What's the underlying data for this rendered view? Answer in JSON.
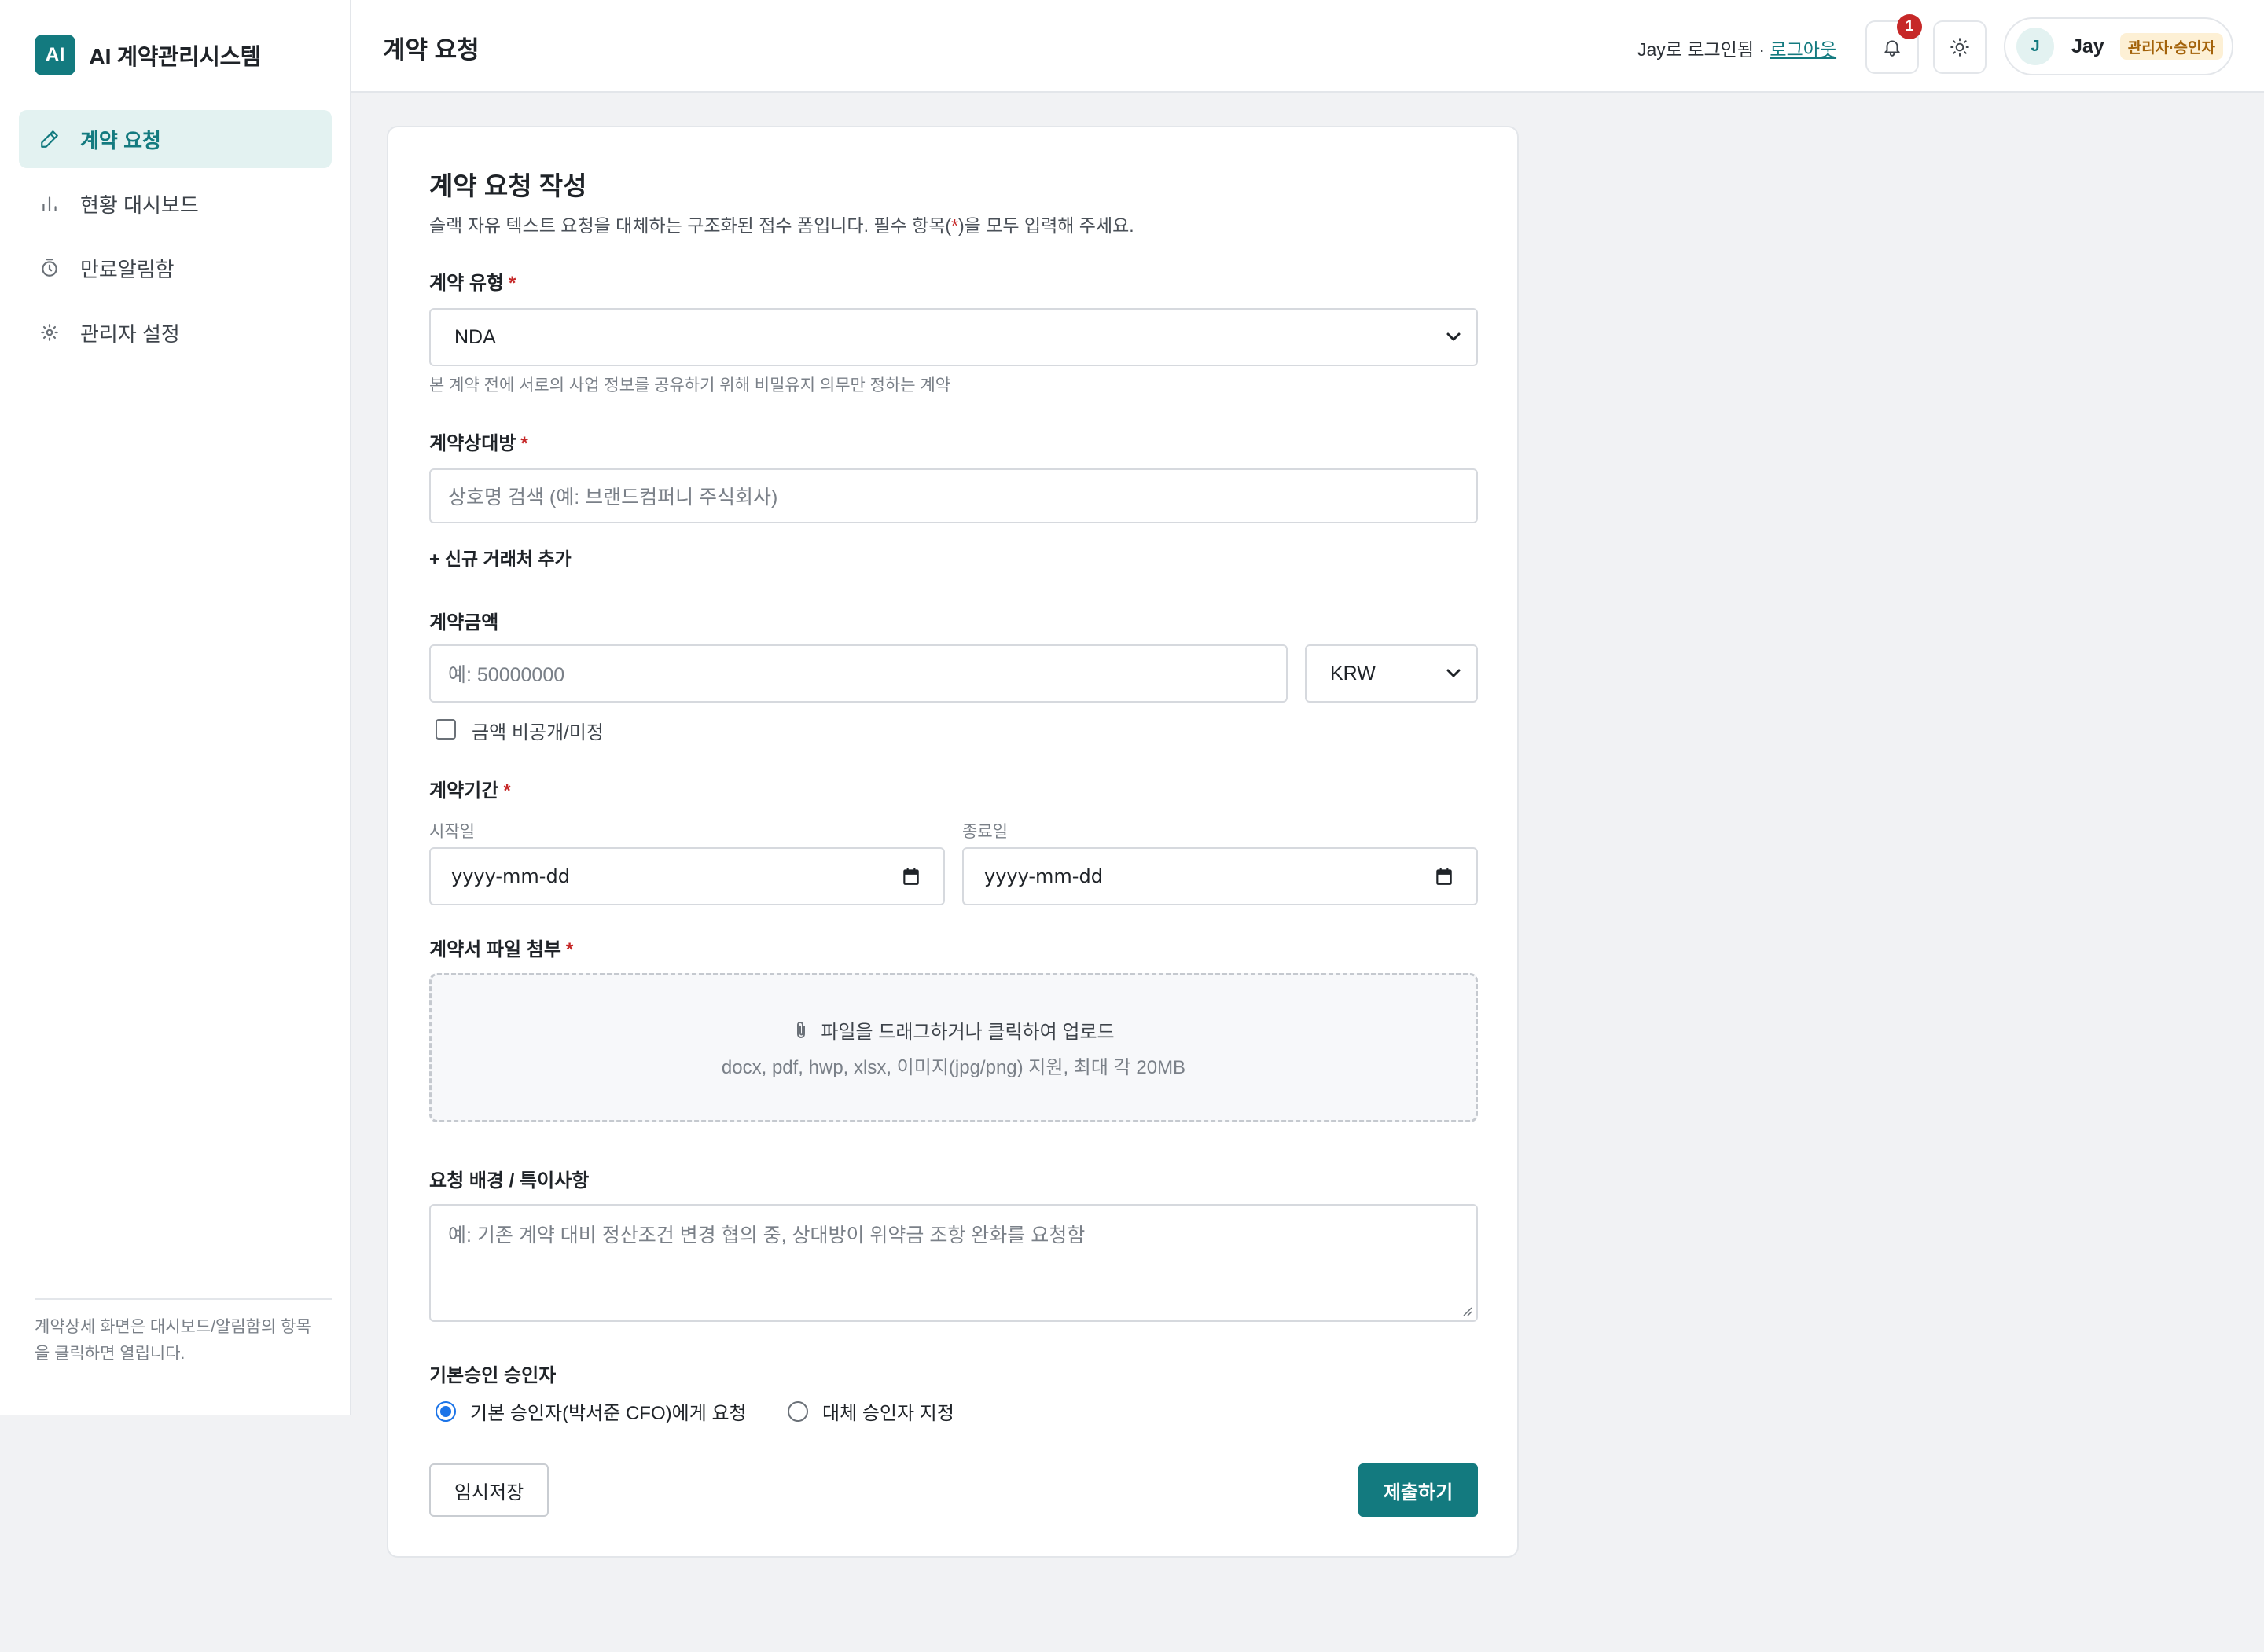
{
  "app": {
    "logo_text": "AI",
    "name": "AI 계약관리시스템"
  },
  "sidebar": {
    "items": [
      {
        "label": "계약 요청",
        "icon": "pencil-icon",
        "active": true
      },
      {
        "label": "현황 대시보드",
        "icon": "bar-chart-icon",
        "active": false
      },
      {
        "label": "만료알림함",
        "icon": "timer-icon",
        "active": false
      },
      {
        "label": "관리자 설정",
        "icon": "gear-icon",
        "active": false
      }
    ],
    "note": "계약상세 화면은 대시보드/알림함의 항목을 클릭하면 열립니다."
  },
  "header": {
    "title": "계약 요청",
    "login_text": "Jay로 로그인됨 · ",
    "logout_label": "로그아웃",
    "notification_count": "1",
    "user": {
      "initial": "J",
      "name": "Jay",
      "role": "관리자·승인자"
    }
  },
  "form": {
    "title": "계약 요청 작성",
    "description": {
      "before": "슬랙 자유 텍스트 요청을 대체하는 구조화된 접수 폼입니다. 필수 항목(",
      "star": "*",
      "after": ")을 모두 입력해 주세요."
    },
    "required_mark": "*",
    "contract_type": {
      "label": "계약 유형",
      "value": "NDA",
      "hint": "본 계약 전에 서로의 사업 정보를 공유하기 위해 비밀유지 의무만 정하는 계약"
    },
    "counterparty": {
      "label": "계약상대방",
      "placeholder": "상호명 검색 (예: 브랜드컴퍼니 주식회사)",
      "add_link": "+ 신규 거래처 추가"
    },
    "amount": {
      "label": "계약금액",
      "placeholder": "예: 50000000",
      "currency": "KRW",
      "undisclosed_label": "금액 비공개/미정",
      "undisclosed_checked": false
    },
    "period": {
      "label": "계약기간",
      "start_label": "시작일",
      "start_value": "yyyy-mm-dd",
      "end_label": "종료일",
      "end_value": "yyyy-mm-dd"
    },
    "attachment": {
      "label": "계약서 파일 첨부",
      "drop_text": "파일을 드래그하거나 클릭하여 업로드",
      "formats": "docx, pdf, hwp, xlsx, 이미지(jpg/png) 지원, 최대 각 20MB"
    },
    "background": {
      "label": "요청 배경 / 특이사항",
      "placeholder": "예: 기존 계약 대비 정산조건 변경 협의 중, 상대방이 위약금 조항 완화를 요청함"
    },
    "approver": {
      "label": "기본승인 승인자",
      "options": [
        {
          "label": "기본 승인자(박서준 CFO)에게 요청",
          "checked": true
        },
        {
          "label": "대체 승인자 지정",
          "checked": false
        }
      ]
    },
    "buttons": {
      "draft": "임시저장",
      "submit": "제출하기"
    }
  },
  "colors": {
    "accent": "#137a7f",
    "required": "#c62828",
    "radio": "#1a73e8",
    "role_badge_bg": "#fdf0d5",
    "role_badge_text": "#a3620a"
  }
}
